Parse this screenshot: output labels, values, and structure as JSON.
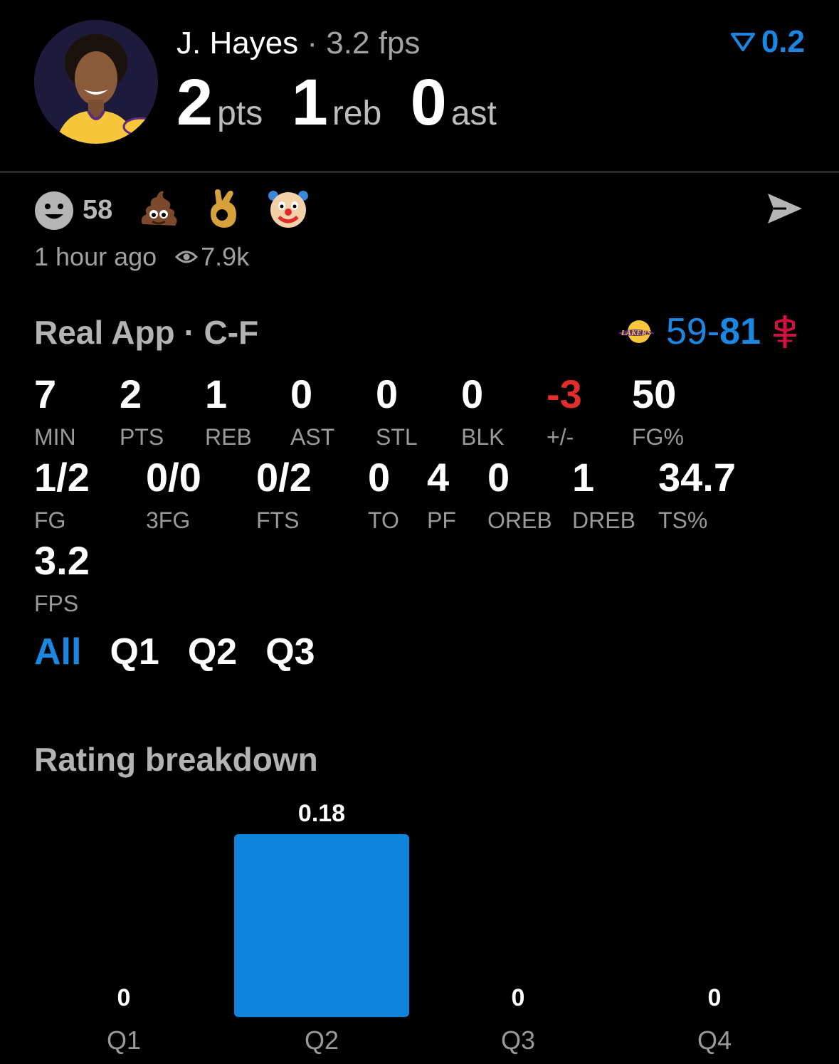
{
  "header": {
    "player_name": "J. Hayes",
    "separator": "·",
    "fps_line": "3.2 fps",
    "pts_value": "2",
    "pts_unit": "pts",
    "reb_value": "1",
    "reb_unit": "reb",
    "ast_value": "0",
    "ast_unit": "ast",
    "rating": "0.2",
    "accent_color": "#1a87e3"
  },
  "reactions": {
    "smiley_count": "58",
    "emojis": [
      "pile-of-poo",
      "ok-hand",
      "clown-face"
    ]
  },
  "meta": {
    "time": "1 hour ago",
    "views": "7.9k"
  },
  "game": {
    "source": "Real App",
    "separator": "·",
    "position": "C-F",
    "home_score": "59",
    "dash": "-",
    "away_score": "81",
    "home_team_icon": "lakers-logo-icon",
    "away_team_icon": "rockets-logo-icon"
  },
  "stats_row1": [
    {
      "value": "7",
      "label": "MIN"
    },
    {
      "value": "2",
      "label": "PTS"
    },
    {
      "value": "1",
      "label": "REB"
    },
    {
      "value": "0",
      "label": "AST"
    },
    {
      "value": "0",
      "label": "STL"
    },
    {
      "value": "0",
      "label": "BLK"
    },
    {
      "value": "-3",
      "label": "+/-"
    },
    {
      "value": "50",
      "label": "FG%"
    }
  ],
  "stats_row2": [
    {
      "value": "1/2",
      "label": "FG"
    },
    {
      "value": "0/0",
      "label": "3FG"
    },
    {
      "value": "0/2",
      "label": "FTS"
    },
    {
      "value": "0",
      "label": "TO"
    },
    {
      "value": "4",
      "label": "PF"
    },
    {
      "value": "0",
      "label": "OREB"
    },
    {
      "value": "1",
      "label": "DREB"
    },
    {
      "value": "34.7",
      "label": "TS%"
    }
  ],
  "stats_row3": [
    {
      "value": "3.2",
      "label": "FPS"
    }
  ],
  "tabs": [
    "All",
    "Q1",
    "Q2",
    "Q3"
  ],
  "chart_title": "Rating breakdown",
  "chart_data": {
    "type": "bar",
    "title": "Rating breakdown",
    "categories": [
      "Q1",
      "Q2",
      "Q3",
      "Q4"
    ],
    "values": [
      0,
      0.18,
      0,
      0
    ],
    "value_labels": [
      "0",
      "0.18",
      "0",
      "0"
    ],
    "bar_color": "#0e84dc",
    "ylim": [
      0,
      0.18
    ],
    "grid": false
  }
}
